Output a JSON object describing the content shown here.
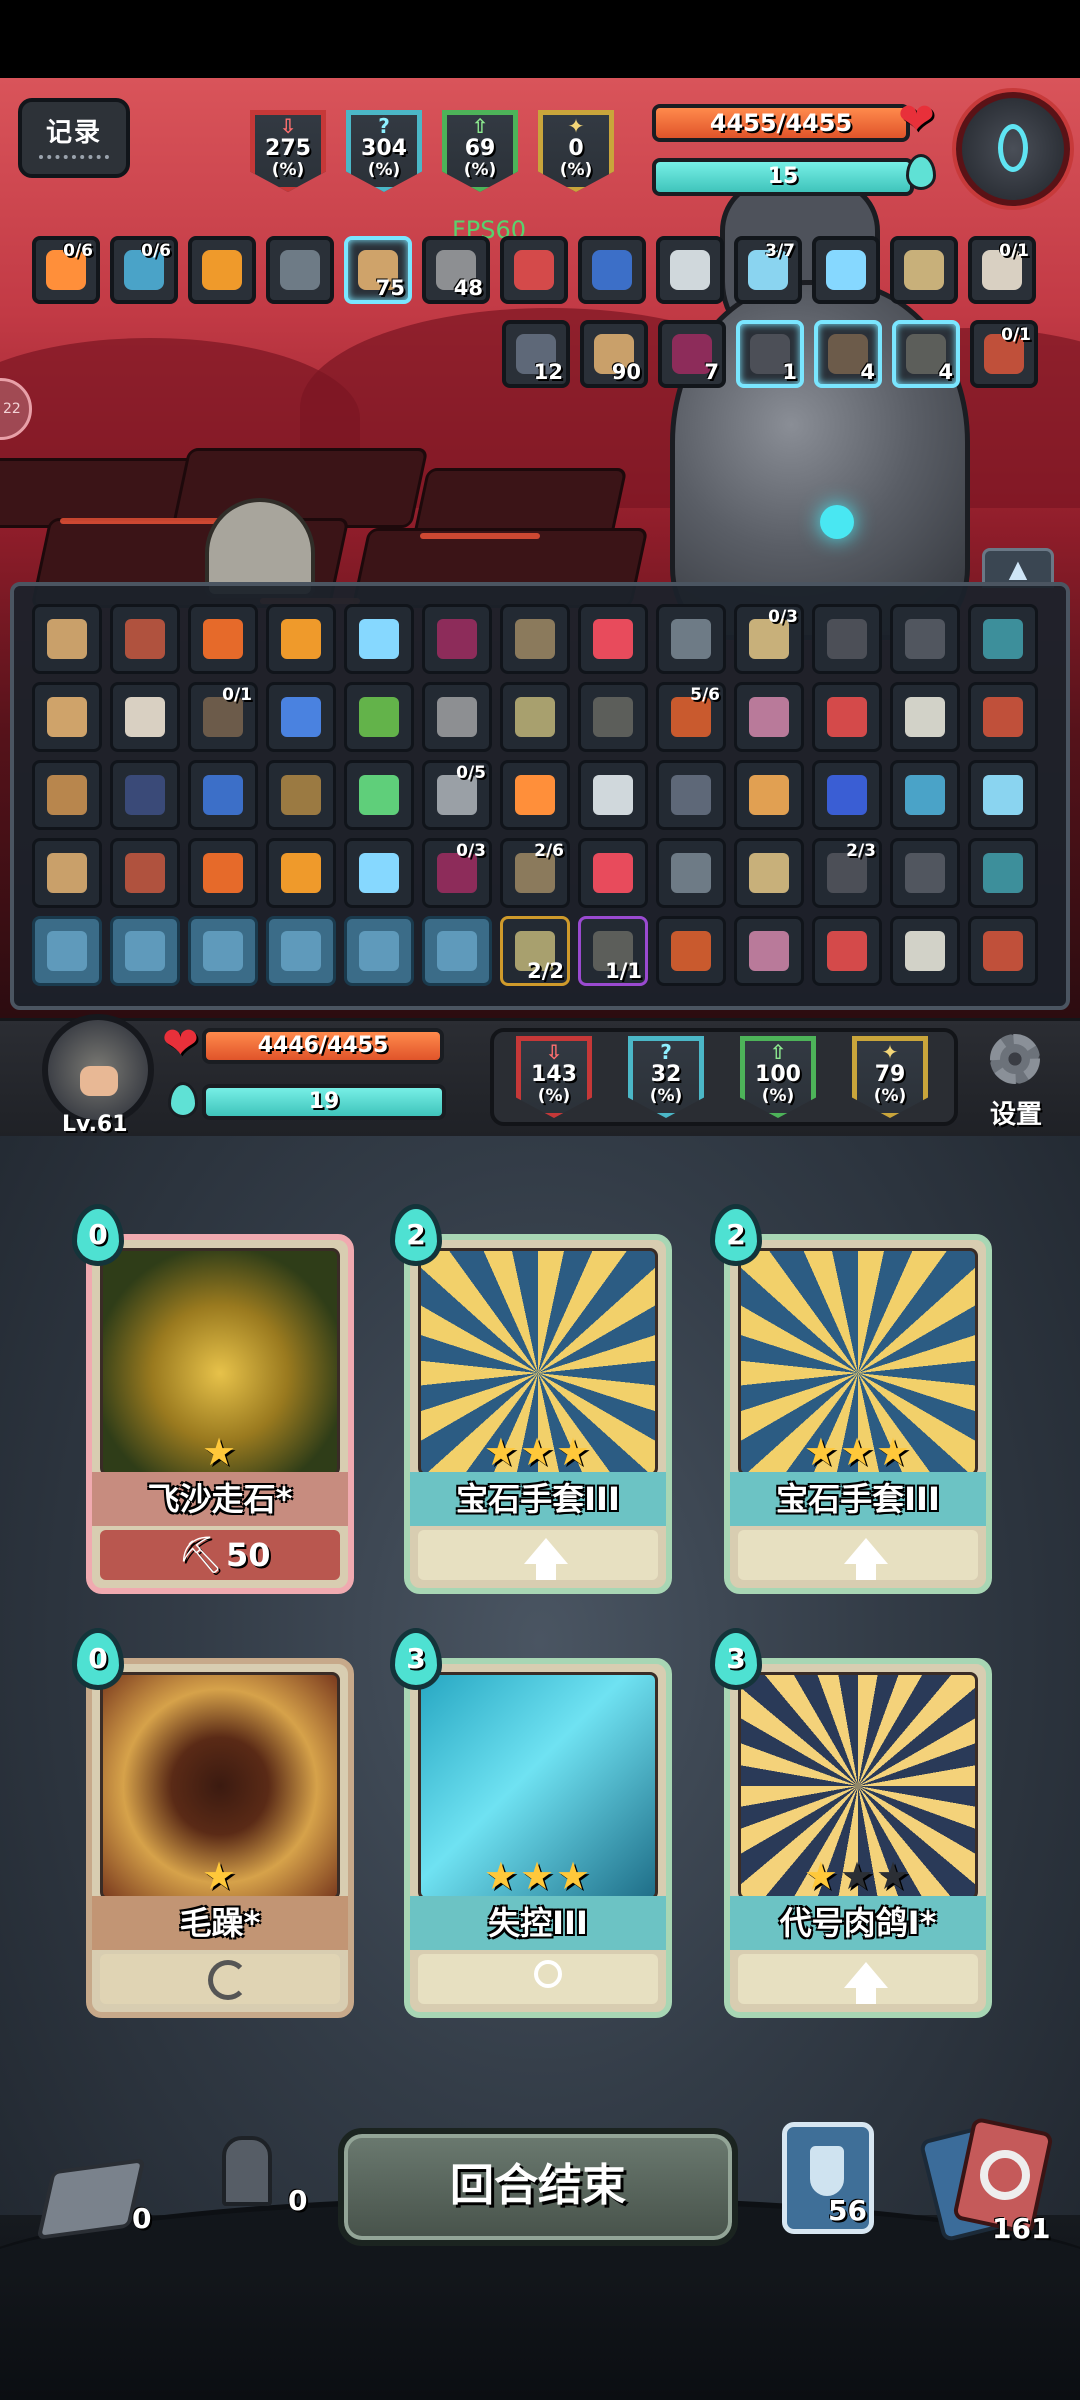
{
  "top_hud": {
    "record_label": "记录",
    "fps": "FPS60",
    "enemy_stats": [
      {
        "value": "275",
        "unit": "(%)",
        "color": "red"
      },
      {
        "value": "304",
        "unit": "(%)",
        "color": "blue"
      },
      {
        "value": "69",
        "unit": "(%)",
        "color": "green"
      },
      {
        "value": "0",
        "unit": "(%)",
        "color": "gold"
      }
    ],
    "enemy_hp": {
      "text": "4455/4455",
      "current": 4455,
      "max": 4455
    },
    "enemy_energy": {
      "text": "15",
      "fraction": 1.0
    },
    "enemy_portrait_icon": "one-eyed-robot-icon"
  },
  "status_row1": [
    {
      "icon": "scroll-icon",
      "top": "0/6",
      "bottom": ""
    },
    {
      "icon": "rune-book-icon",
      "top": "0/6",
      "bottom": ""
    },
    {
      "icon": "fire-orb-icon",
      "top": "",
      "bottom": ""
    },
    {
      "icon": "torch-icon",
      "top": "",
      "bottom": ""
    },
    {
      "icon": "ghost-icon",
      "top": "",
      "bottom": "75"
    },
    {
      "icon": "down-arrow-debuff-icon",
      "top": "",
      "bottom": "48"
    },
    {
      "icon": "book-icon",
      "top": "",
      "bottom": ""
    },
    {
      "icon": "pink-monster-icon",
      "top": "",
      "bottom": ""
    },
    {
      "icon": "claw-icon",
      "top": "",
      "bottom": ""
    },
    {
      "icon": "pocket-watch-icon",
      "top": "3/7",
      "bottom": ""
    },
    {
      "icon": "spiked-ball-icon",
      "top": "",
      "bottom": ""
    },
    {
      "icon": "feather-icon",
      "top": "",
      "bottom": ""
    },
    {
      "icon": "eye-orb-icon",
      "top": "0/1",
      "bottom": ""
    }
  ],
  "status_row2": [
    {
      "icon": "poison-skull-icon",
      "top": "",
      "bottom": "12"
    },
    {
      "icon": "flame-icon",
      "top": "",
      "bottom": "90"
    },
    {
      "icon": "slash-icon",
      "top": "",
      "bottom": "7"
    },
    {
      "icon": "lightning-icon",
      "top": "",
      "bottom": "1"
    },
    {
      "icon": "crosshair-icon",
      "top": "",
      "bottom": "4"
    },
    {
      "icon": "snowflake-icon",
      "top": "",
      "bottom": "4"
    },
    {
      "icon": "sack-icon",
      "top": "0/1",
      "bottom": ""
    }
  ],
  "inventory": {
    "toggle_icon": "collapse-up-icon",
    "rows": [
      [
        {
          "icon": "scroll-item-icon",
          "top": "",
          "bottom": ""
        },
        {
          "icon": "bone-icon",
          "top": "",
          "bottom": ""
        },
        {
          "icon": "sticks-icon",
          "top": "",
          "bottom": ""
        },
        {
          "icon": "sword-icon",
          "top": "",
          "bottom": ""
        },
        {
          "icon": "green-emblem-icon",
          "top": "",
          "bottom": ""
        },
        {
          "icon": "stone-shard-icon",
          "top": "",
          "bottom": ""
        },
        {
          "icon": "pistol-icon",
          "top": "",
          "bottom": ""
        },
        {
          "icon": "trident-icon",
          "top": "",
          "bottom": ""
        },
        {
          "icon": "fire-staff-icon",
          "top": "",
          "bottom": ""
        },
        {
          "icon": "tentacle-icon",
          "top": "0/3",
          "bottom": ""
        },
        {
          "icon": "wand-icon",
          "top": "",
          "bottom": ""
        },
        {
          "icon": "glove-icon",
          "top": "",
          "bottom": ""
        },
        {
          "icon": "pouch-icon",
          "top": "",
          "bottom": ""
        }
      ],
      [
        {
          "icon": "fang-icon",
          "top": "",
          "bottom": ""
        },
        {
          "icon": "dark-cube-icon",
          "top": "",
          "bottom": ""
        },
        {
          "icon": "bell-charm-icon",
          "top": "0/1",
          "bottom": ""
        },
        {
          "icon": "mortar-icon",
          "top": "",
          "bottom": ""
        },
        {
          "icon": "goggles-icon",
          "top": "",
          "bottom": ""
        },
        {
          "icon": "scales-icon",
          "top": "",
          "bottom": ""
        },
        {
          "icon": "balance-icon",
          "top": "",
          "bottom": ""
        },
        {
          "icon": "armor-icon",
          "top": "",
          "bottom": ""
        },
        {
          "icon": "spellbook-icon",
          "top": "5/6",
          "bottom": ""
        },
        {
          "icon": "water-orb-icon",
          "top": "",
          "bottom": ""
        },
        {
          "icon": "torch-item-icon",
          "top": "",
          "bottom": ""
        },
        {
          "icon": "bandage-icon",
          "top": "",
          "bottom": ""
        },
        {
          "icon": "hammer-icon",
          "top": "",
          "bottom": ""
        }
      ],
      [
        {
          "icon": "egg-helmet-icon",
          "top": "",
          "bottom": ""
        },
        {
          "icon": "shield-emblem-icon",
          "top": "",
          "bottom": ""
        },
        {
          "icon": "boot-icon",
          "top": "",
          "bottom": ""
        },
        {
          "icon": "eye-mask-icon",
          "top": "",
          "bottom": ""
        },
        {
          "icon": "swirl-gem-icon",
          "top": "",
          "bottom": ""
        },
        {
          "icon": "ring-icon",
          "top": "0/5",
          "bottom": ""
        },
        {
          "icon": "green-helmet-icon",
          "top": "",
          "bottom": ""
        },
        {
          "icon": "medal-icon",
          "top": "",
          "bottom": ""
        },
        {
          "icon": "dragon-icon",
          "top": "",
          "bottom": ""
        },
        {
          "icon": "mask-icon",
          "top": "",
          "bottom": ""
        },
        {
          "icon": "meat-icon",
          "top": "",
          "bottom": ""
        },
        {
          "icon": "rose-icon",
          "top": "",
          "bottom": ""
        },
        {
          "icon": "green-egg-icon",
          "top": "",
          "bottom": ""
        }
      ],
      [
        {
          "icon": "water-splash-icon",
          "top": "",
          "bottom": ""
        },
        {
          "icon": "steak-icon",
          "top": "",
          "bottom": ""
        },
        {
          "icon": "round-shield-icon",
          "top": "",
          "bottom": ""
        },
        {
          "icon": "gear-box-icon",
          "top": "",
          "bottom": ""
        },
        {
          "icon": "boxing-glove-icon",
          "top": "",
          "bottom": ""
        },
        {
          "icon": "tome-icon",
          "top": "0/3",
          "bottom": ""
        },
        {
          "icon": "paper-icon",
          "top": "2/6",
          "bottom": ""
        },
        {
          "icon": "ice-cream-icon",
          "top": "",
          "bottom": ""
        },
        {
          "icon": "potion-bottle-icon",
          "top": "",
          "bottom": ""
        },
        {
          "icon": "teacup-icon",
          "top": "",
          "bottom": ""
        },
        {
          "icon": "red-egg-icon",
          "top": "2/3",
          "bottom": ""
        },
        {
          "icon": "helmet-icon",
          "top": "",
          "bottom": ""
        },
        {
          "icon": "fish-icon",
          "top": "",
          "bottom": ""
        }
      ],
      [
        {
          "icon": "robot-silhouette-icon",
          "top": "",
          "bottom": "",
          "style": "blue"
        },
        {
          "icon": "bow-silhouette-icon",
          "top": "",
          "bottom": "",
          "style": "blue"
        },
        {
          "icon": "dragon-silhouette-icon",
          "top": "",
          "bottom": "",
          "style": "blue"
        },
        {
          "icon": "horn-silhouette-icon",
          "top": "",
          "bottom": "",
          "style": "blue"
        },
        {
          "icon": "skull-silhouette-icon",
          "top": "",
          "bottom": "",
          "style": "blue"
        },
        {
          "icon": "crystal-silhouette-icon",
          "top": "",
          "bottom": "",
          "style": "blue"
        },
        {
          "icon": "bullet-icon",
          "top": "",
          "bottom": "2/2",
          "style": "gold"
        },
        {
          "icon": "shell-icon",
          "top": "",
          "bottom": "1/1",
          "style": "purple"
        },
        {
          "icon": "creature-icon",
          "top": "",
          "bottom": ""
        },
        {
          "icon": "picture-frame-icon",
          "top": "",
          "bottom": ""
        },
        {
          "icon": "crab-icon",
          "top": "",
          "bottom": ""
        },
        {
          "icon": "broom-icon",
          "top": "",
          "bottom": ""
        },
        {
          "icon": "bread-icon",
          "top": "",
          "bottom": ""
        }
      ]
    ]
  },
  "player_hud": {
    "level": "Lv.61",
    "hp": {
      "text": "4446/4455",
      "current": 4446,
      "max": 4455
    },
    "energy": {
      "text": "19",
      "fraction": 1.0
    },
    "stats": [
      {
        "value": "143",
        "unit": "(%)",
        "color": "red"
      },
      {
        "value": "32",
        "unit": "(%)",
        "color": "blue"
      },
      {
        "value": "100",
        "unit": "(%)",
        "color": "green"
      },
      {
        "value": "79",
        "unit": "(%)",
        "color": "gold"
      }
    ],
    "settings_label": "设置"
  },
  "hand": [
    {
      "name": "飞沙走石*",
      "cost": "0",
      "stars": 1,
      "max_stars": 1,
      "frame": "pink",
      "name_style": "rose",
      "foot_style": "rose",
      "foot_icon": "axe-icon",
      "foot_value": "50",
      "art": "golden-bells-art"
    },
    {
      "name": "宝石手套III",
      "cost": "2",
      "stars": 3,
      "max_stars": 3,
      "frame": "green",
      "name_style": "teal",
      "foot_style": "cream",
      "foot_icon": "upgrade-arrow-icon",
      "foot_value": "",
      "art": "gem-gauntlet-art"
    },
    {
      "name": "宝石手套III",
      "cost": "2",
      "stars": 3,
      "max_stars": 3,
      "frame": "green",
      "name_style": "teal",
      "foot_style": "cream",
      "foot_icon": "upgrade-arrow-icon",
      "foot_value": "",
      "art": "gem-gauntlet-art"
    },
    {
      "name": "毛躁*",
      "cost": "0",
      "stars": 1,
      "max_stars": 1,
      "frame": "gold",
      "name_style": "tan",
      "foot_style": "tan",
      "foot_icon": "spiral-icon",
      "foot_value": "",
      "art": "skull-mask-art"
    },
    {
      "name": "失控III",
      "cost": "3",
      "stars": 3,
      "max_stars": 3,
      "frame": "green",
      "name_style": "teal",
      "foot_style": "cream",
      "foot_icon": "lightbulb-icon",
      "foot_value": "",
      "art": "robot-claw-art"
    },
    {
      "name": "代号肉鸽I*",
      "cost": "3",
      "stars": 1,
      "max_stars": 3,
      "frame": "green",
      "name_style": "teal",
      "foot_style": "cream",
      "foot_icon": "upgrade-arrow-icon",
      "foot_value": "",
      "art": "golden-device-art"
    }
  ],
  "bottom_bar": {
    "discard_count": "0",
    "graveyard_count": "0",
    "end_turn_label": "回合结束",
    "potion_count": "56",
    "deck_count": "161"
  }
}
